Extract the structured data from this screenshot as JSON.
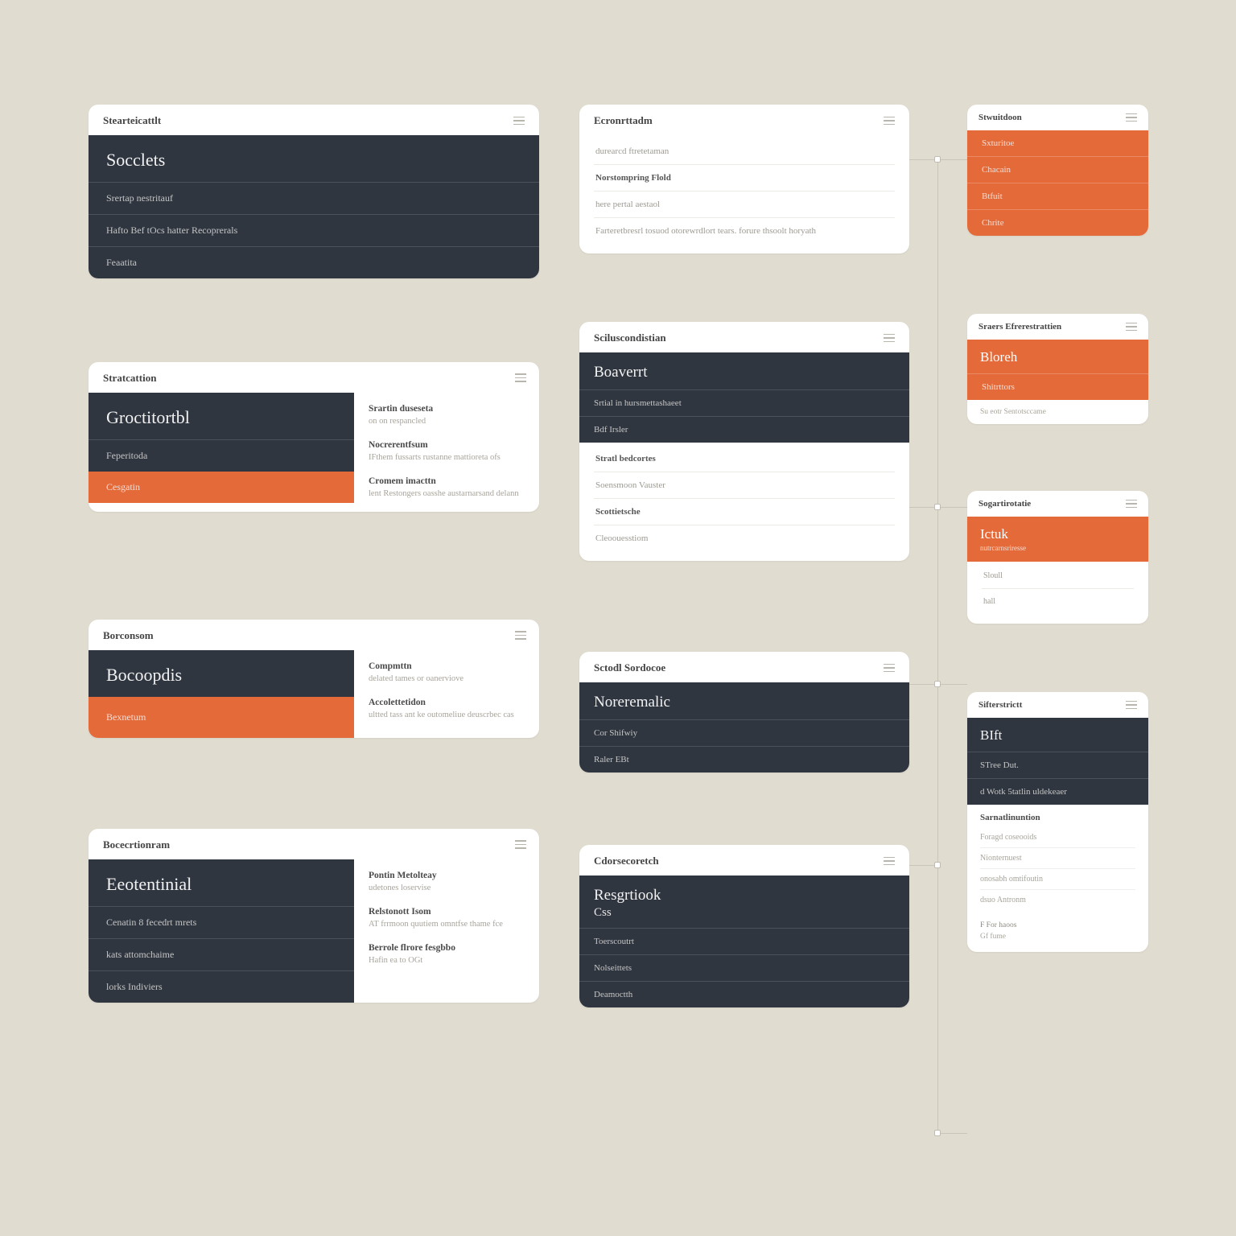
{
  "colA": {
    "card1": {
      "header": "Stearteicattlt",
      "title": "Socclets",
      "rows": [
        "Srertap nestritauf",
        "Hafto Bef tOcs hatter Recoprerals",
        "Feaatita"
      ]
    },
    "card2": {
      "header": "Stratcattion",
      "dark": {
        "title": "Groctitortbl",
        "rows": [
          "Feperitoda"
        ]
      },
      "orange": {
        "rows": [
          "Cesgatin"
        ]
      },
      "side": [
        {
          "label": "Srartin duseseta",
          "text": "on on respancled"
        },
        {
          "label": "Nocrerentfsum",
          "text": "IFthem fussarts rustanne mattioreta ofs"
        },
        {
          "label": "Cromem imacttn",
          "text": "lent Restongers oasshe austarnarsand delann"
        }
      ]
    },
    "card3": {
      "header": "Borconsom",
      "dark": {
        "title": "Bocoopdis"
      },
      "orange": {
        "rows": [
          "Bexnetum"
        ]
      },
      "side": [
        {
          "label": "Compmttn",
          "text": "delated tames or oanerviove"
        },
        {
          "label": "Accolettetidon",
          "text": "ultted tass ant ke outomeliue deuscrbec cas"
        }
      ]
    },
    "card4": {
      "header": "Bocecrtionram",
      "title": "Eeotentinial",
      "rows": [
        "Cenatin 8 fecedrt mrets",
        "kats attomchaime",
        "lorks Indiviers"
      ],
      "side": [
        {
          "label": "Pontin Metolteay",
          "text": "udetones loservise"
        },
        {
          "label": "Relstonott Isom",
          "text": "AT frrmoon quutiem omntfse thame fce"
        },
        {
          "label": "Berrole flrore fesgbbo",
          "text": "Hafin ea to OGt"
        }
      ]
    }
  },
  "colB": {
    "card1": {
      "header": "Ecronrttadm",
      "rows": [
        {
          "strong": false,
          "text": "durearcd ftretetaman"
        },
        {
          "strong": true,
          "text": "Norstompring Flold"
        },
        {
          "strong": false,
          "text": "here pertal aestaol"
        },
        {
          "strong": false,
          "text": "Farteretbresrl tosuod otorewrdlort tears. forure thsoolt horyath"
        }
      ]
    },
    "card2": {
      "header": "Sciluscondistian",
      "title": "Boaverrt",
      "darkRows": [
        "Srtial in hursmettashaeet",
        "Bdf Irsler"
      ],
      "lightRows": [
        {
          "strong": true,
          "text": "Stratl bedcortes"
        },
        {
          "strong": false,
          "text": "Soensmoon Vauster"
        },
        {
          "strong": true,
          "text": "Scottietsche"
        },
        {
          "strong": false,
          "text": "Cleoouesstiom"
        }
      ]
    },
    "card3": {
      "header": "Sctodl Sordocoe",
      "title": "Noreremalic",
      "rows": [
        "Cor Shifwiy",
        "Raler EBt"
      ]
    },
    "card4": {
      "header": "Cdorsecoretch",
      "title": "Resgrtiook",
      "subtitle": "Css",
      "rows": [
        "Toerscoutrt",
        "Nolseittets",
        "Deamoctth"
      ]
    }
  },
  "colC": {
    "card1": {
      "header": "Stwuitdoon",
      "rows": [
        "Sxturitoe",
        "Chacain",
        "Btfuit",
        "Chrite"
      ]
    },
    "card2": {
      "header": "Sraers Efrerestrattien",
      "title": "Bloreh",
      "rows": [
        "Shitrttors"
      ],
      "footer": "Su eotr Sentotsccame"
    },
    "card3": {
      "header": "Sogartirotatie",
      "title": "Ictuk",
      "sub": "nutrcarnsriresse",
      "lightRows": [
        "Sloull",
        "hall"
      ]
    },
    "card4": {
      "header": "Sifterstrictt",
      "title": "BIft",
      "rows": [
        "STree Dut.",
        "d Wotk 5tatlin uldekeaer"
      ],
      "sectionLabel": "Sarnatlinuntion",
      "miniRows": [
        "Foragd coseooids",
        "Nionternuest",
        "onosabh omtifoutin",
        "dsuo Antronm"
      ],
      "footerLabel": "F   For haoos",
      "footerText": "Gf fume"
    }
  }
}
